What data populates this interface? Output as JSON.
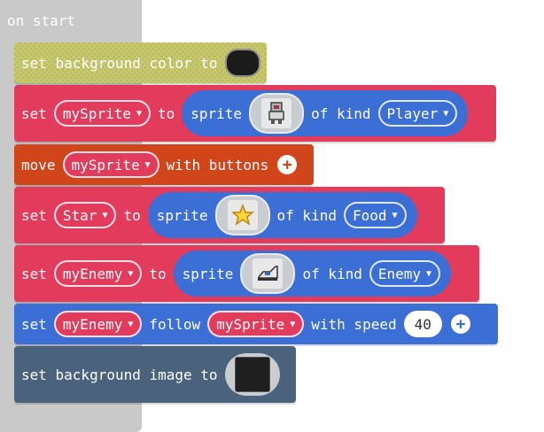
{
  "on_start": {
    "label": "on start"
  },
  "blocks": {
    "set_bg_color": {
      "label": "set background color to",
      "color": "#1b1b1b"
    },
    "set_mysprite": {
      "set": "set",
      "variable": "mySprite",
      "to": "to",
      "sprite": "sprite",
      "of_kind": "of kind",
      "kind": "Player",
      "sprite_icon": "astronaut-sprite-icon"
    },
    "move": {
      "move": "move",
      "variable": "mySprite",
      "with_buttons": "with buttons"
    },
    "set_star": {
      "set": "set",
      "variable": "Star",
      "to": "to",
      "sprite": "sprite",
      "of_kind": "of kind",
      "kind": "Food",
      "sprite_icon": "star-sprite-icon"
    },
    "set_myenemy": {
      "set": "set",
      "variable": "myEnemy",
      "to": "to",
      "sprite": "sprite",
      "of_kind": "of kind",
      "kind": "Enemy",
      "sprite_icon": "car-sprite-icon"
    },
    "follow": {
      "set": "set",
      "variable": "myEnemy",
      "follow": "follow",
      "target": "mySprite",
      "with_speed": "with speed",
      "speed": "40"
    },
    "set_bg_image": {
      "label": "set background image to",
      "image_icon": "background-image-icon"
    }
  },
  "colors": {
    "sprites": "#e23b5c",
    "controller": "#d1451a",
    "scene": "#4b627d",
    "follow": "#3b6fd6",
    "event": "#c9c9c9",
    "disabled": "#c7c76f"
  }
}
